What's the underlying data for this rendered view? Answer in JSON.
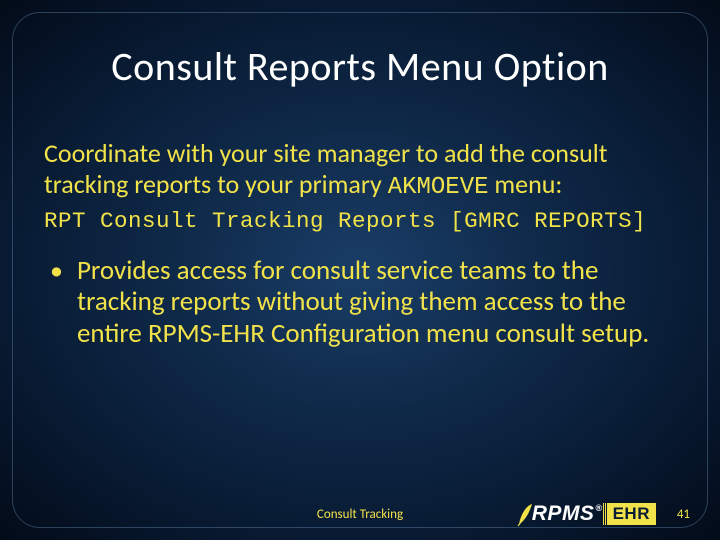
{
  "title": "Consult Reports Menu Option",
  "intro_part1": "Coordinate with your site manager to add the consult tracking reports to your primary ",
  "intro_mono": "AKMOEVE",
  "intro_part2": " menu:",
  "code_line": "RPT Consult Tracking Reports [GMRC REPORTS]",
  "bullet_text": "Provides access for consult service teams to the tracking reports without giving them access to the entire RPMS-EHR Configuration menu consult setup.",
  "footer_label": "Consult Tracking",
  "page_number": "41",
  "logo": {
    "rpms": "RPMS",
    "reg": "®",
    "ehr": "EHR"
  }
}
